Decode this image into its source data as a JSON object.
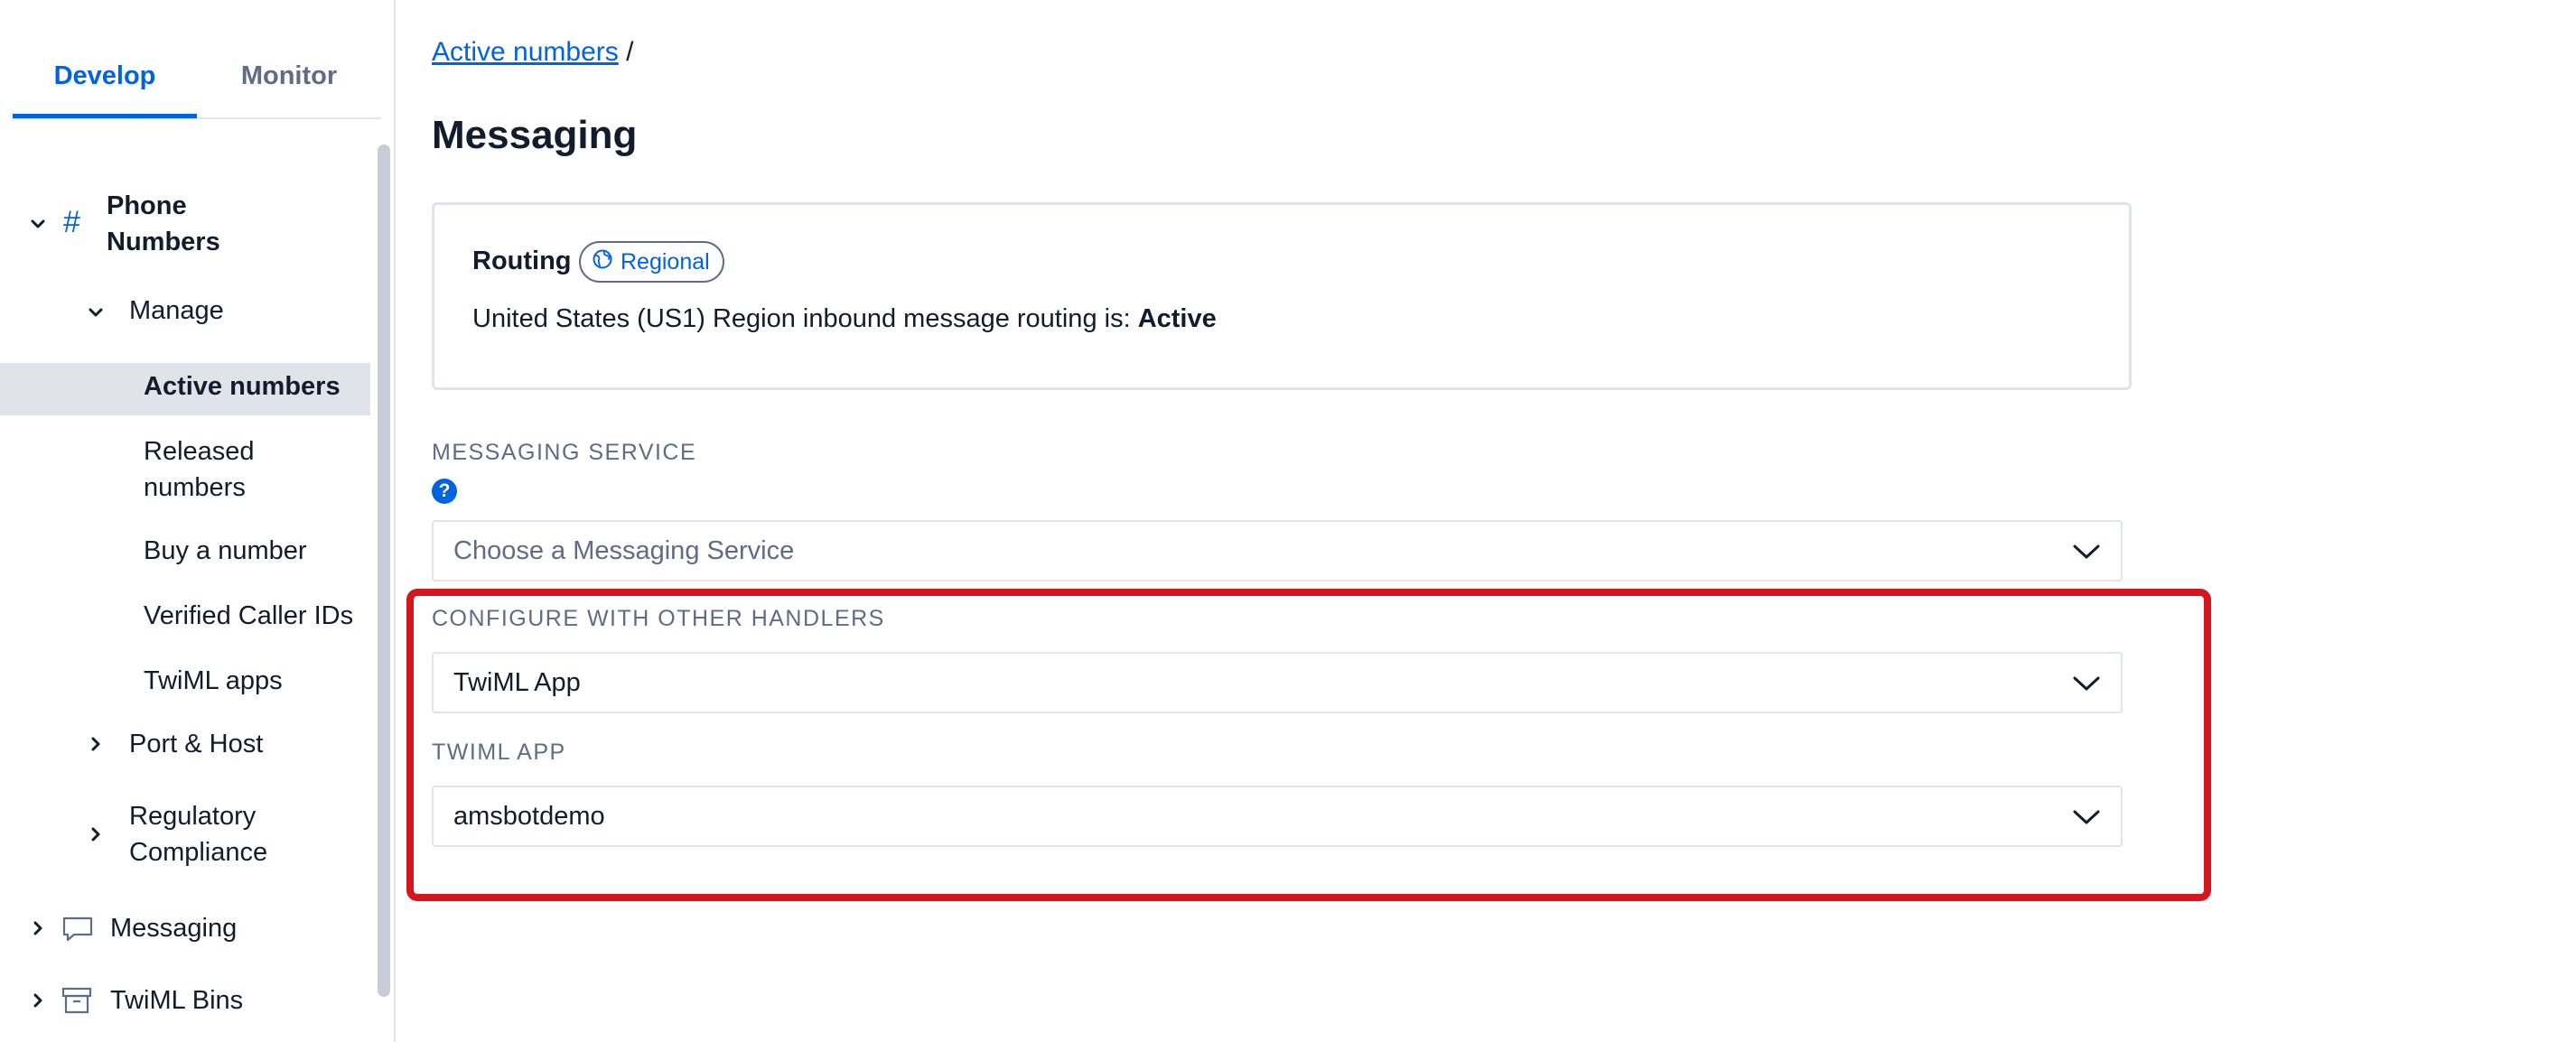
{
  "sidebar": {
    "tabs": [
      {
        "label": "Develop"
      },
      {
        "label": "Monitor"
      }
    ],
    "phone_numbers": {
      "label_line1": "Phone",
      "label_line2": "Numbers",
      "icon": "hash-icon"
    },
    "manage": {
      "label": "Manage"
    },
    "manage_items": [
      {
        "label": "Active numbers"
      },
      {
        "label_line1": "Released",
        "label_line2": "numbers"
      },
      {
        "label": "Buy a number"
      },
      {
        "label": "Verified Caller IDs"
      },
      {
        "label": "TwiML apps"
      }
    ],
    "port_host": {
      "label": "Port & Host"
    },
    "regulatory": {
      "label_line1": "Regulatory",
      "label_line2": "Compliance"
    },
    "messaging": {
      "label": "Messaging",
      "icon": "chat-bubble-icon"
    },
    "twiml_bins": {
      "label": "TwiML Bins",
      "icon": "archive-box-icon"
    }
  },
  "main": {
    "breadcrumb": {
      "link": "Active numbers",
      "separator": "/"
    },
    "title": "Messaging",
    "routing": {
      "label": "Routing",
      "badge": "Regional",
      "badge_icon": "globe-icon",
      "text_prefix": "United States (US1) Region inbound message routing is:",
      "status": "Active"
    },
    "messaging_service": {
      "label": "MESSAGING SERVICE",
      "placeholder": "Choose a Messaging Service"
    },
    "other_handlers": {
      "label": "CONFIGURE WITH OTHER HANDLERS",
      "value": "TwiML App"
    },
    "twiml_app": {
      "label": "TWIML APP",
      "value": "amsbotdemo"
    }
  },
  "colors": {
    "accent": "#0263e0",
    "highlight": "#d6161f",
    "text": "#121c2d",
    "muted": "#606b85",
    "border": "#e1e3ea"
  }
}
